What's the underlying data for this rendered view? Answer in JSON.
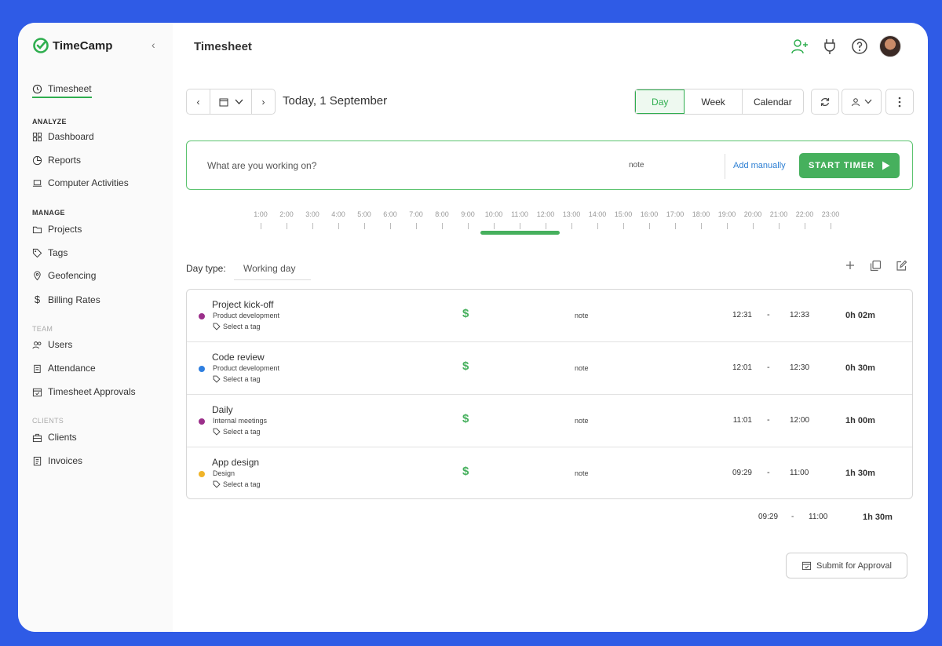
{
  "app": {
    "name": "TimeCamp"
  },
  "sidebar": {
    "timesheet": "Timesheet",
    "analyze": {
      "heading": "ANALYZE",
      "items": [
        "Dashboard",
        "Reports",
        "Computer Activities"
      ]
    },
    "manage": {
      "heading": "MANAGE",
      "items": [
        "Projects",
        "Tags",
        "Geofencing",
        "Billing Rates"
      ]
    },
    "team": {
      "heading": "TEAM",
      "items": [
        "Users",
        "Attendance",
        "Timesheet Approvals"
      ]
    },
    "clients": {
      "heading": "CLIENTS",
      "items": [
        "Clients",
        "Invoices"
      ]
    }
  },
  "header": {
    "title": "Timesheet"
  },
  "toolbar": {
    "date_label": "Today, 1 September",
    "views": [
      "Day",
      "Week",
      "Calendar"
    ],
    "active_view": "Day"
  },
  "timer": {
    "placeholder": "What are you working on?",
    "note": "note",
    "add_manually": "Add manually",
    "start": "START TIMER"
  },
  "timeline": {
    "hours": [
      "1:00",
      "2:00",
      "3:00",
      "4:00",
      "5:00",
      "6:00",
      "7:00",
      "8:00",
      "9:00",
      "10:00",
      "11:00",
      "12:00",
      "13:00",
      "14:00",
      "15:00",
      "16:00",
      "17:00",
      "18:00",
      "19:00",
      "20:00",
      "21:00",
      "22:00",
      "23:00"
    ],
    "tracked_from": "09:29",
    "tracked_to": "12:33"
  },
  "day_type": {
    "label": "Day type:",
    "value": "Working day"
  },
  "entries": [
    {
      "title": "Project kick-off",
      "project": "Product development",
      "tag": "Select a tag",
      "dollar": "$",
      "note": "note",
      "start": "12:31",
      "dash": "-",
      "end": "12:33",
      "duration": "0h 02m",
      "color": "#9b2f8a"
    },
    {
      "title": "Code review",
      "project": "Product development",
      "tag": "Select a tag",
      "dollar": "$",
      "note": "note",
      "start": "12:01",
      "dash": "-",
      "end": "12:30",
      "duration": "0h 30m",
      "color": "#2f7fe0"
    },
    {
      "title": "Daily",
      "project": "Internal meetings",
      "tag": "Select a tag",
      "dollar": "$",
      "note": "note",
      "start": "11:01",
      "dash": "-",
      "end": "12:00",
      "duration": "1h 00m",
      "color": "#9b2f8a"
    },
    {
      "title": "App design",
      "project": "Design",
      "tag": "Select a tag",
      "dollar": "$",
      "note": "note",
      "start": "09:29",
      "dash": "-",
      "end": "11:00",
      "duration": "1h 30m",
      "color": "#f0b429"
    }
  ],
  "totals": {
    "start": "09:29",
    "dash": "-",
    "end": "11:00",
    "duration": "1h 30m"
  },
  "submit": {
    "label": "Submit for Approval"
  }
}
